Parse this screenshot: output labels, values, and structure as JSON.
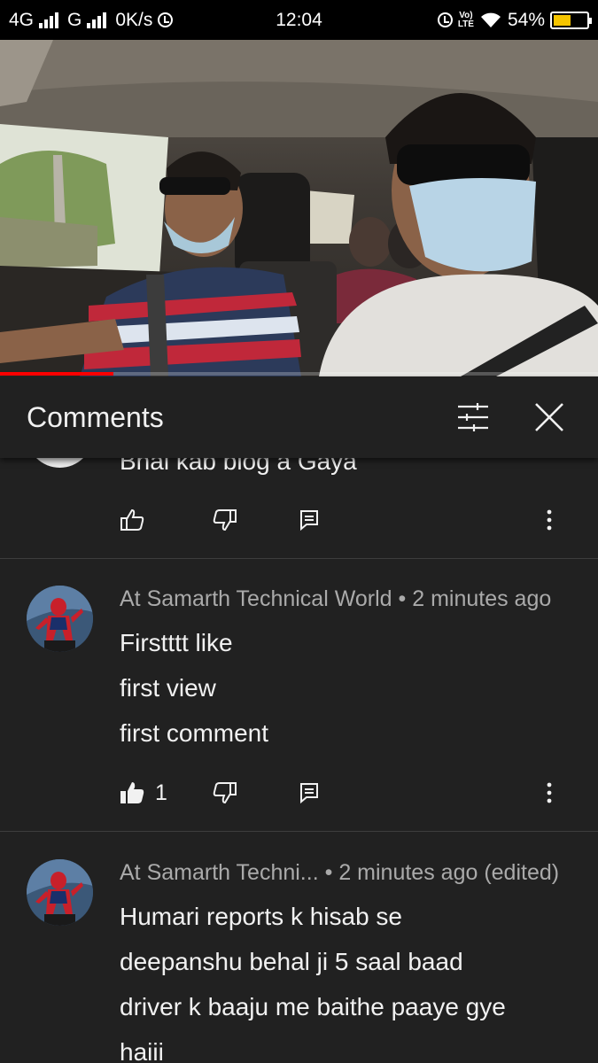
{
  "status_bar": {
    "network_1": "4G",
    "network_2": "G",
    "speed": "0K/s",
    "time": "12:04",
    "volte_top": "Vo)",
    "volte_bottom": "LTE",
    "battery": "54%",
    "battery_level": 0.54,
    "battery_color": "#f6c500"
  },
  "video": {
    "progress": 0.19,
    "progress_color": "#ff0000"
  },
  "comments_panel": {
    "title": "Comments",
    "filter_icon": "filter-sliders-icon",
    "close_icon": "close-icon"
  },
  "comments": [
    {
      "lines": [
        "Bhai kab blog a Gaya"
      ],
      "likes": ""
    },
    {
      "author": "At Samarth Technical World",
      "separator": "•",
      "time": "2 minutes ago",
      "lines": [
        "Firstttt like",
        "first view",
        "first comment"
      ],
      "likes": "1"
    },
    {
      "author": "At Samarth Techni...",
      "separator": "•",
      "time": "2 minutes ago (edited)",
      "lines": [
        "Humari reports k hisab se",
        "deepanshu behal ji 5 saal baad",
        "driver k baaju me baithe paaye gye",
        "haiii"
      ]
    }
  ]
}
